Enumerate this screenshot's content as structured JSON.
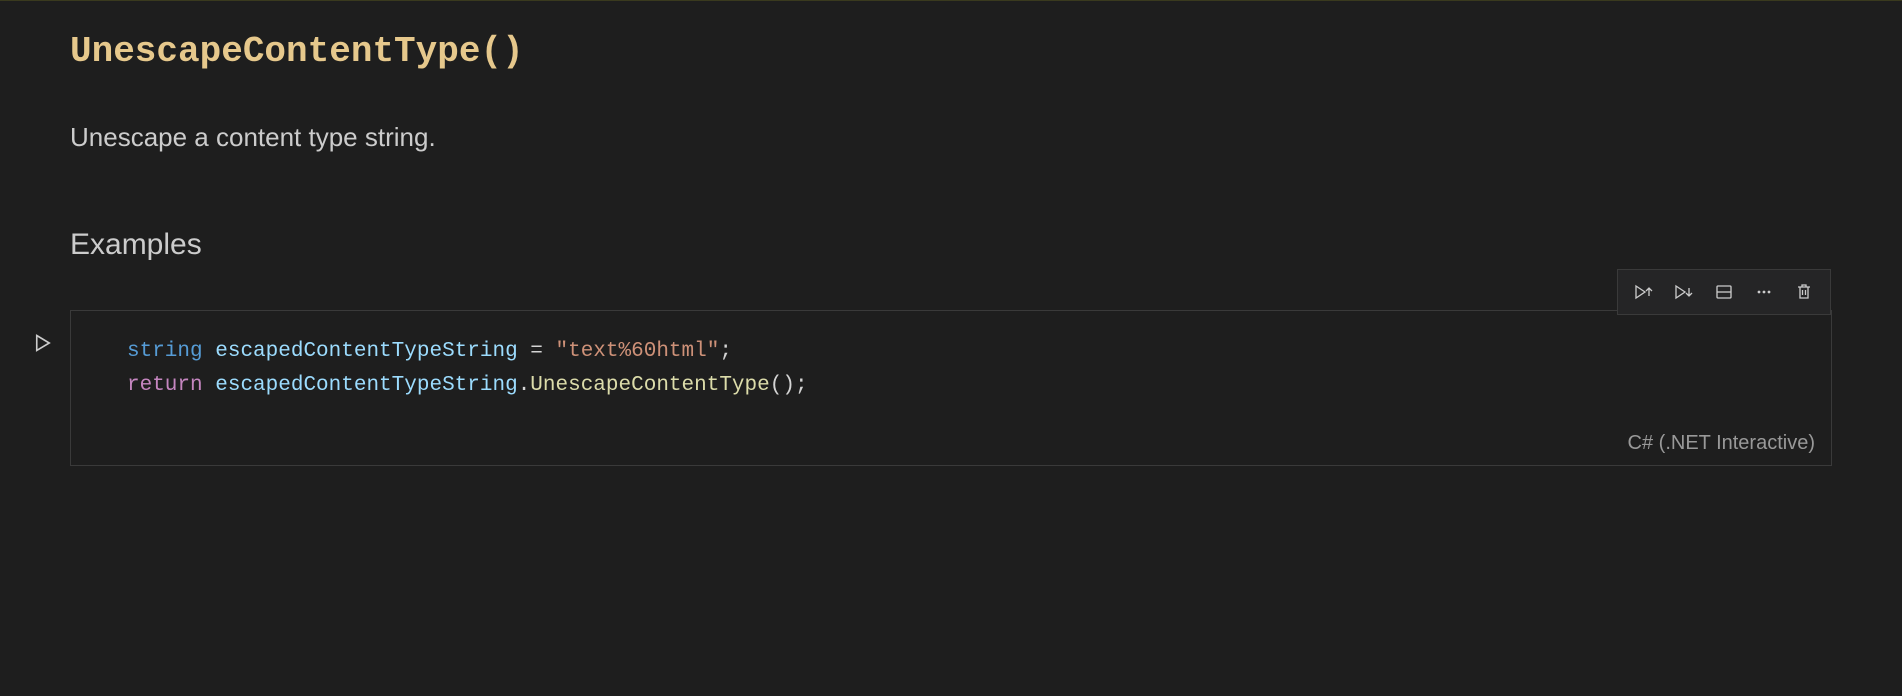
{
  "doc": {
    "method_title": "UnescapeContentType()",
    "description": "Unescape a content type string.",
    "examples_heading": "Examples"
  },
  "cell": {
    "language_label": "C# (.NET Interactive)",
    "code": {
      "line1": {
        "kw_string": "string",
        "var": "escapedContentTypeString",
        "eq": " = ",
        "str": "\"text%60html\"",
        "semi": ";"
      },
      "line2": {
        "kw_return": "return",
        "var": "escapedContentTypeString",
        "dot": ".",
        "method": "UnescapeContentType",
        "parens": "()",
        "semi": ";"
      }
    }
  }
}
